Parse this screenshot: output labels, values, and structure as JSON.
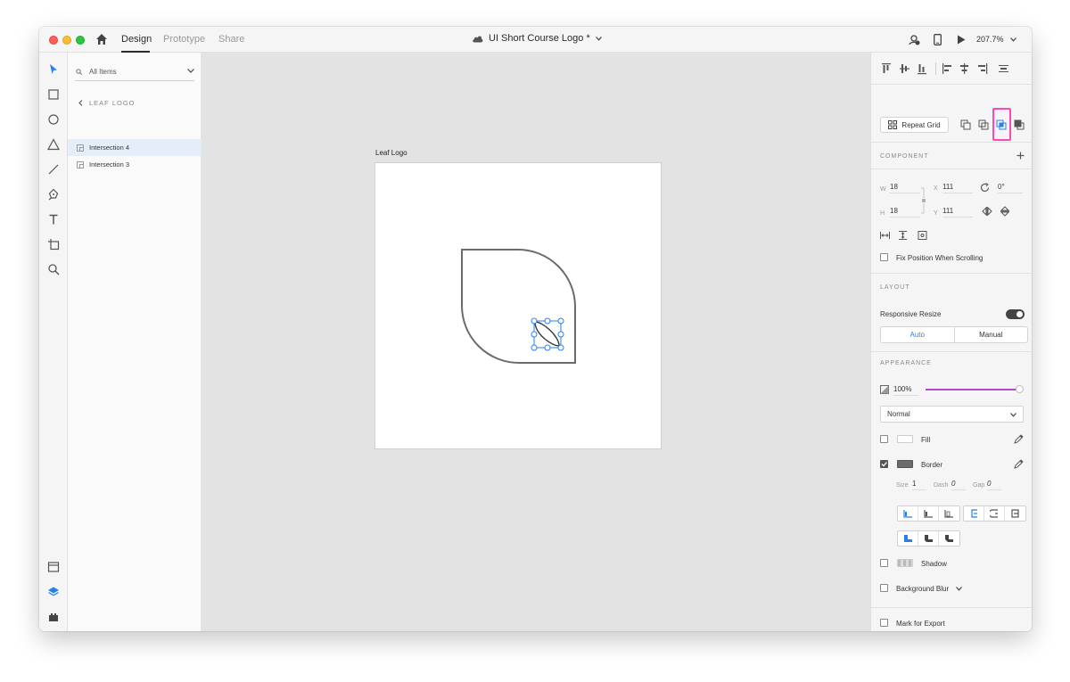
{
  "titlebar": {
    "tabs": [
      "Design",
      "Prototype",
      "Share"
    ],
    "active_tab": "Design",
    "document_title": "UI Short Course Logo *",
    "zoom": "207.7%"
  },
  "layers": {
    "filter_label": "All Items",
    "breadcrumb": "LEAF LOGO",
    "items": [
      {
        "label": "Intersection 4",
        "selected": true
      },
      {
        "label": "Intersection 3",
        "selected": false
      }
    ]
  },
  "canvas": {
    "artboard_label": "Leaf Logo"
  },
  "panel": {
    "repeat_grid_label": "Repeat Grid",
    "component_title": "COMPONENT",
    "w_label": "W",
    "w_value": "18",
    "h_label": "H",
    "h_value": "18",
    "x_label": "X",
    "x_value": "111",
    "y_label": "Y",
    "y_value": "111",
    "rotation_value": "0°",
    "fix_position_label": "Fix Position When Scrolling",
    "layout_title": "LAYOUT",
    "responsive_resize_label": "Responsive Resize",
    "auto_label": "Auto",
    "manual_label": "Manual",
    "appearance_title": "APPEARANCE",
    "opacity_value": "100%",
    "opacity_level": 1.0,
    "blend_mode": "Normal",
    "fill_label": "Fill",
    "border_label": "Border",
    "size_label": "Size",
    "size_value": "1",
    "dash_label": "Dash",
    "dash_value": "0",
    "gap_label": "Gap",
    "gap_value": "0",
    "shadow_label": "Shadow",
    "background_blur_label": "Background Blur",
    "mark_export_label": "Mark for Export"
  },
  "colors": {
    "accent_blue": "#2680eb",
    "opacity_slider": "#b04bc8",
    "highlight": "#ff48b8",
    "border_swatch": "#6b6b6b"
  }
}
